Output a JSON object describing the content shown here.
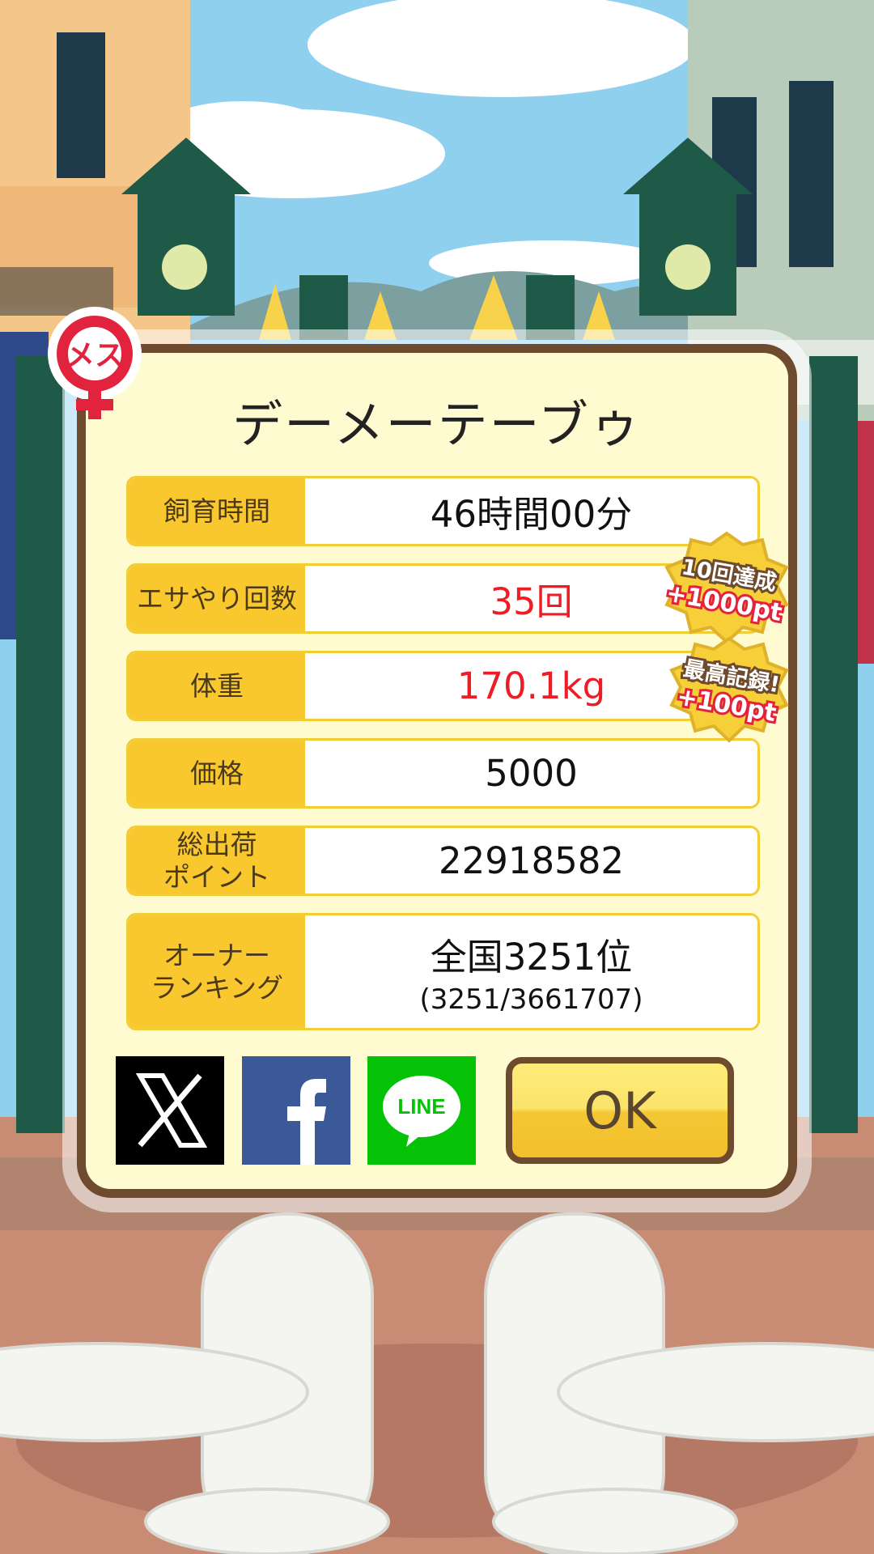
{
  "dialog": {
    "title": "デーメーテーブゥ",
    "gender_badge": "メス",
    "rows": [
      {
        "label": "飼育時間",
        "value": "46時間00分"
      },
      {
        "label": "エサやり回数",
        "value": "35回"
      },
      {
        "label": "体重",
        "value": "170.1kg"
      },
      {
        "label": "価格",
        "value": "5000"
      },
      {
        "label_line1": "総出荷",
        "label_line2": "ポイント",
        "value": "22918582"
      },
      {
        "label_line1": "オーナー",
        "label_line2": "ランキング",
        "value": "全国3251位",
        "sub": "(3251/3661707)"
      }
    ],
    "badges": [
      {
        "line1": "10回達成",
        "line2": "+1000pt"
      },
      {
        "line1": "最高記録!",
        "line2": "+100pt"
      }
    ],
    "share": {
      "x_icon": "x-logo-icon",
      "facebook_icon": "facebook-logo-icon",
      "line_label": "LINE"
    },
    "ok_label": "OK"
  },
  "colors": {
    "highlight_red": "#ee1c25",
    "label_yellow": "#f8c82e",
    "panel_bg": "#fffbd0",
    "border_brown": "#6e4a2e"
  }
}
